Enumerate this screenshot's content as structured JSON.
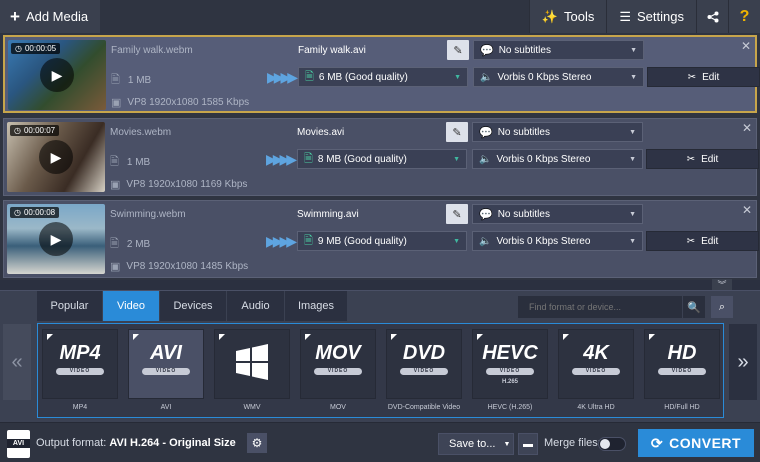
{
  "toolbar": {
    "add_media_label": "Add Media",
    "tools_label": "Tools",
    "settings_label": "Settings",
    "help_label": "?"
  },
  "files": [
    {
      "duration": "00:00:05",
      "source_name": "Family walk.webm",
      "source_size": "1 MB",
      "source_meta": "VP8 1920x1080 1585 Kbps",
      "output_name": "Family walk.avi",
      "output_size": "6 MB (Good quality)",
      "subtitles": "No subtitles",
      "audio": "Vorbis 0 Kbps Stereo",
      "edit_label": "Edit"
    },
    {
      "duration": "00:00:07",
      "source_name": "Movies.webm",
      "source_size": "1 MB",
      "source_meta": "VP8 1920x1080 1169 Kbps",
      "output_name": "Movies.avi",
      "output_size": "8 MB (Good quality)",
      "subtitles": "No subtitles",
      "audio": "Vorbis 0 Kbps Stereo",
      "edit_label": "Edit"
    },
    {
      "duration": "00:00:08",
      "source_name": "Swimming.webm",
      "source_size": "2 MB",
      "source_meta": "VP8 1920x1080 1485 Kbps",
      "output_name": "Swimming.avi",
      "output_size": "9 MB (Good quality)",
      "subtitles": "No subtitles",
      "audio": "Vorbis 0 Kbps Stereo",
      "edit_label": "Edit"
    }
  ],
  "format_tabs": [
    "Popular",
    "Video",
    "Devices",
    "Audio",
    "Images"
  ],
  "active_tab": "Video",
  "search": {
    "placeholder": "Find format or device..."
  },
  "presets": [
    {
      "logo": "MP4",
      "pill": "VIDEO",
      "sub": "",
      "label": "MP4"
    },
    {
      "logo": "AVI",
      "pill": "VIDEO",
      "sub": "",
      "label": "AVI"
    },
    {
      "logo": "",
      "pill": "",
      "sub": "",
      "label": "WMV"
    },
    {
      "logo": "MOV",
      "pill": "VIDEO",
      "sub": "",
      "label": "MOV"
    },
    {
      "logo": "DVD",
      "pill": "VIDEO",
      "sub": "",
      "label": "DVD-Compatible Video"
    },
    {
      "logo": "HEVC",
      "pill": "VIDEO",
      "sub": "H.265",
      "label": "HEVC (H.265)"
    },
    {
      "logo": "4K",
      "pill": "VIDEO",
      "sub": "",
      "label": "4K Ultra HD"
    },
    {
      "logo": "HD",
      "pill": "VIDEO",
      "sub": "",
      "label": "HD/Full HD"
    }
  ],
  "bottom": {
    "format_icon_tag": "AVI",
    "output_format_prefix": "Output format:",
    "output_format_value": "AVI H.264 - Original Size",
    "save_to_label": "Save to...",
    "merge_label": "Merge files:",
    "convert_label": "CONVERT"
  },
  "colors": {
    "accent": "#2a8bd8",
    "selected_border": "#c7a54b",
    "help": "#f0b400"
  }
}
